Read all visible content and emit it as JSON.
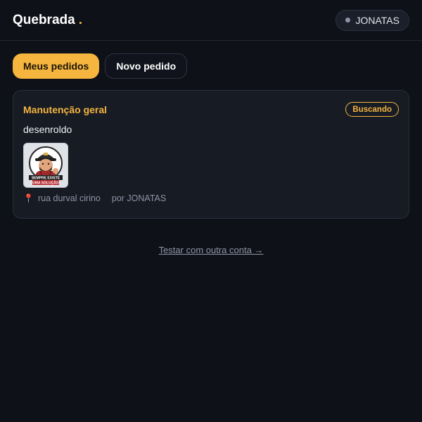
{
  "header": {
    "brand": "Quebrada",
    "brand_dot": ".",
    "user_name": "JONATAS"
  },
  "tabs": [
    {
      "label": "Meus pedidos",
      "active": true
    },
    {
      "label": "Novo pedido",
      "active": false
    }
  ],
  "orders": [
    {
      "title": "Manutenção geral",
      "status": "Buscando",
      "description": "desenroldo",
      "address": "rua durval cirino",
      "author": "por JONATAS",
      "image_text_line1": "SEMPRE EXISTE",
      "image_text_line2": "UMA SOLUÇÃO"
    }
  ],
  "footer": {
    "switch_account": "Testar com outra conta →"
  },
  "colors": {
    "accent": "#f5b53f",
    "background": "#0f1118",
    "card": "#171b24"
  }
}
